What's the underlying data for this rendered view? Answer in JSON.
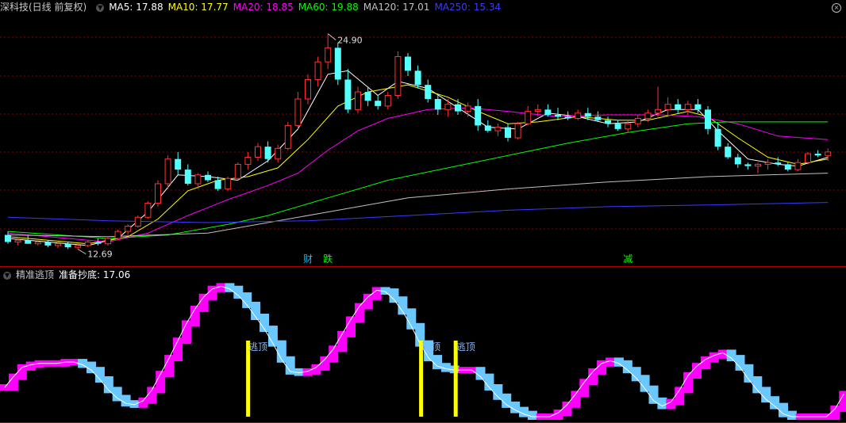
{
  "panel1": {
    "title": "深科技(日线 前复权)",
    "ma_labels": [
      {
        "text": "MA5: 17.88",
        "color": "#ffffff"
      },
      {
        "text": "MA10: 17.77",
        "color": "#ffff00"
      },
      {
        "text": "MA20: 18.85",
        "color": "#ff00ff"
      },
      {
        "text": "MA60: 19.88",
        "color": "#00ff00"
      },
      {
        "text": "MA120: 17.01",
        "color": "#c0c0c0"
      },
      {
        "text": "MA250: 15.34",
        "color": "#3a3aff"
      }
    ],
    "high_label": "24.90",
    "low_label": "12.69",
    "markers": [
      {
        "text": "财",
        "color": "#00c0ff",
        "index": 30
      },
      {
        "text": "跌",
        "color": "#00ff00",
        "index": 32
      },
      {
        "text": "减",
        "color": "#00ff00",
        "index": 62
      }
    ]
  },
  "panel2": {
    "title": "精准逃顶",
    "sub_label": "准备抄底: 17.06",
    "signal_text": "逃顶"
  },
  "colors": {
    "up": "#ff3232",
    "down": "#54ffff",
    "grid": "#8b0000",
    "osc_up": "#ff00ff",
    "osc_down": "#6ac8ff",
    "signal": "#ffff00"
  },
  "chart_data": [
    {
      "type": "candlestick",
      "title": "深科技(日线 前复权)",
      "ylim": [
        12.0,
        26.0
      ],
      "ohlc": [
        [
          13.5,
          13.7,
          13.0,
          13.1
        ],
        [
          13.1,
          13.3,
          12.9,
          13.2
        ],
        [
          13.2,
          13.5,
          13.0,
          13.0
        ],
        [
          13.0,
          13.3,
          12.9,
          13.1
        ],
        [
          13.1,
          13.2,
          12.8,
          12.9
        ],
        [
          12.9,
          13.1,
          12.75,
          13.0
        ],
        [
          13.0,
          13.1,
          12.7,
          12.8
        ],
        [
          12.8,
          13.0,
          12.69,
          12.9
        ],
        [
          12.9,
          13.2,
          12.8,
          13.1
        ],
        [
          13.1,
          13.3,
          12.9,
          13.0
        ],
        [
          13.0,
          13.4,
          12.9,
          13.3
        ],
        [
          13.3,
          13.8,
          13.2,
          13.7
        ],
        [
          13.7,
          14.1,
          13.5,
          14.0
        ],
        [
          14.0,
          14.6,
          13.9,
          14.5
        ],
        [
          14.5,
          15.4,
          14.4,
          15.3
        ],
        [
          15.3,
          16.6,
          15.1,
          16.4
        ],
        [
          16.4,
          18.0,
          16.1,
          17.8
        ],
        [
          17.8,
          18.2,
          16.9,
          17.2
        ],
        [
          17.2,
          17.5,
          16.3,
          16.4
        ],
        [
          16.4,
          17.0,
          16.1,
          16.9
        ],
        [
          16.9,
          17.1,
          16.5,
          16.6
        ],
        [
          16.6,
          16.8,
          16.0,
          16.1
        ],
        [
          16.1,
          16.8,
          16.0,
          16.7
        ],
        [
          16.7,
          17.6,
          16.6,
          17.5
        ],
        [
          17.5,
          18.2,
          17.2,
          17.9
        ],
        [
          17.9,
          18.7,
          17.7,
          18.5
        ],
        [
          18.5,
          18.8,
          17.6,
          17.8
        ],
        [
          17.8,
          18.6,
          17.6,
          18.4
        ],
        [
          18.4,
          19.9,
          18.3,
          19.7
        ],
        [
          19.7,
          21.6,
          19.5,
          21.2
        ],
        [
          21.2,
          22.6,
          20.9,
          22.3
        ],
        [
          22.3,
          23.6,
          21.9,
          23.3
        ],
        [
          23.3,
          24.9,
          22.9,
          24.1
        ],
        [
          24.1,
          24.4,
          22.0,
          22.3
        ],
        [
          22.3,
          22.9,
          20.4,
          20.6
        ],
        [
          20.6,
          21.9,
          20.4,
          21.6
        ],
        [
          21.6,
          21.9,
          20.8,
          21.1
        ],
        [
          21.1,
          21.4,
          20.6,
          20.8
        ],
        [
          20.8,
          21.6,
          20.6,
          21.4
        ],
        [
          21.4,
          23.9,
          21.2,
          23.6
        ],
        [
          23.6,
          23.8,
          22.5,
          22.8
        ],
        [
          22.8,
          23.1,
          21.8,
          22.0
        ],
        [
          22.0,
          22.3,
          21.0,
          21.2
        ],
        [
          21.2,
          21.5,
          20.3,
          20.6
        ],
        [
          20.6,
          21.2,
          20.2,
          20.9
        ],
        [
          20.9,
          21.2,
          20.3,
          20.5
        ],
        [
          20.5,
          21.0,
          20.2,
          20.8
        ],
        [
          20.8,
          21.2,
          19.4,
          19.7
        ],
        [
          19.7,
          20.0,
          19.3,
          19.4
        ],
        [
          19.4,
          19.8,
          19.1,
          19.6
        ],
        [
          19.6,
          19.8,
          18.8,
          19.0
        ],
        [
          19.0,
          19.9,
          18.9,
          19.8
        ],
        [
          19.8,
          20.8,
          19.7,
          20.5
        ],
        [
          20.5,
          20.9,
          20.2,
          20.6
        ],
        [
          20.6,
          20.9,
          20.2,
          20.3
        ],
        [
          20.3,
          20.7,
          20.0,
          20.2
        ],
        [
          20.2,
          20.5,
          20.0,
          20.1
        ],
        [
          20.1,
          20.6,
          20.0,
          20.4
        ],
        [
          20.4,
          20.7,
          20.0,
          20.2
        ],
        [
          20.2,
          20.5,
          19.9,
          20.0
        ],
        [
          20.0,
          20.2,
          19.6,
          19.8
        ],
        [
          19.8,
          20.0,
          19.4,
          19.5
        ],
        [
          19.5,
          20.0,
          19.3,
          19.8
        ],
        [
          19.8,
          20.3,
          19.6,
          20.1
        ],
        [
          20.1,
          20.6,
          19.9,
          20.4
        ],
        [
          20.4,
          21.9,
          20.2,
          20.6
        ],
        [
          20.6,
          21.3,
          20.3,
          20.9
        ],
        [
          20.9,
          21.2,
          20.4,
          20.6
        ],
        [
          20.6,
          21.1,
          20.3,
          20.9
        ],
        [
          20.9,
          21.2,
          20.4,
          20.6
        ],
        [
          20.6,
          20.8,
          19.2,
          19.5
        ],
        [
          19.5,
          19.8,
          18.3,
          18.5
        ],
        [
          18.5,
          18.7,
          17.8,
          17.9
        ],
        [
          17.9,
          18.1,
          17.3,
          17.5
        ],
        [
          17.5,
          17.6,
          17.2,
          17.4
        ],
        [
          17.4,
          17.6,
          17.0,
          17.5
        ],
        [
          17.5,
          17.8,
          17.2,
          17.6
        ],
        [
          17.6,
          17.9,
          17.4,
          17.5
        ],
        [
          17.5,
          17.6,
          17.1,
          17.2
        ],
        [
          17.2,
          17.8,
          17.1,
          17.6
        ],
        [
          17.6,
          18.2,
          17.5,
          18.1
        ],
        [
          18.1,
          18.3,
          17.9,
          18.0
        ],
        [
          18.0,
          18.4,
          17.7,
          18.2
        ]
      ],
      "ma_lines": {
        "MA5": [
          [
            0,
            13.3
          ],
          [
            6,
            13.0
          ],
          [
            8,
            12.9
          ],
          [
            11,
            13.3
          ],
          [
            14,
            14.8
          ],
          [
            17,
            16.9
          ],
          [
            20,
            16.8
          ],
          [
            23,
            16.6
          ],
          [
            26,
            17.7
          ],
          [
            29,
            19.5
          ],
          [
            32,
            22.6
          ],
          [
            34,
            22.8
          ],
          [
            37,
            21.4
          ],
          [
            39,
            22.2
          ],
          [
            42,
            21.8
          ],
          [
            45,
            20.7
          ],
          [
            48,
            19.6
          ],
          [
            51,
            19.5
          ],
          [
            54,
            20.4
          ],
          [
            57,
            20.2
          ],
          [
            60,
            19.8
          ],
          [
            63,
            19.9
          ],
          [
            66,
            20.6
          ],
          [
            69,
            20.6
          ],
          [
            71,
            19.4
          ],
          [
            74,
            17.8
          ],
          [
            77,
            17.5
          ],
          [
            79,
            17.4
          ],
          [
            82,
            17.9
          ]
        ],
        "MA10": [
          [
            0,
            13.4
          ],
          [
            8,
            13.0
          ],
          [
            12,
            13.4
          ],
          [
            15,
            14.4
          ],
          [
            18,
            16.0
          ],
          [
            21,
            16.6
          ],
          [
            24,
            16.8
          ],
          [
            27,
            17.3
          ],
          [
            30,
            18.9
          ],
          [
            33,
            20.8
          ],
          [
            36,
            21.6
          ],
          [
            40,
            22.0
          ],
          [
            44,
            21.3
          ],
          [
            47,
            20.5
          ],
          [
            50,
            19.8
          ],
          [
            53,
            19.9
          ],
          [
            57,
            20.2
          ],
          [
            61,
            20.0
          ],
          [
            64,
            20.0
          ],
          [
            68,
            20.5
          ],
          [
            70,
            20.2
          ],
          [
            73,
            19.0
          ],
          [
            76,
            17.9
          ],
          [
            79,
            17.5
          ],
          [
            82,
            17.8
          ]
        ],
        "MA20": [
          [
            0,
            13.6
          ],
          [
            10,
            13.1
          ],
          [
            14,
            13.6
          ],
          [
            18,
            14.6
          ],
          [
            22,
            15.5
          ],
          [
            26,
            16.3
          ],
          [
            29,
            17.0
          ],
          [
            32,
            18.3
          ],
          [
            35,
            19.4
          ],
          [
            38,
            20.1
          ],
          [
            42,
            20.6
          ],
          [
            46,
            20.7
          ],
          [
            50,
            20.5
          ],
          [
            55,
            20.2
          ],
          [
            60,
            20.3
          ],
          [
            65,
            20.3
          ],
          [
            69,
            20.2
          ],
          [
            73,
            19.8
          ],
          [
            77,
            19.1
          ],
          [
            82,
            18.9
          ]
        ],
        "MA60": [
          [
            0,
            13.7
          ],
          [
            10,
            13.3
          ],
          [
            16,
            13.5
          ],
          [
            22,
            14.1
          ],
          [
            26,
            14.6
          ],
          [
            32,
            15.6
          ],
          [
            38,
            16.6
          ],
          [
            44,
            17.3
          ],
          [
            50,
            18.0
          ],
          [
            56,
            18.7
          ],
          [
            62,
            19.3
          ],
          [
            68,
            19.8
          ],
          [
            72,
            19.9
          ],
          [
            77,
            19.9
          ],
          [
            82,
            19.9
          ]
        ],
        "MA120": [
          [
            0,
            13.5
          ],
          [
            10,
            13.4
          ],
          [
            20,
            13.6
          ],
          [
            26,
            14.2
          ],
          [
            32,
            14.8
          ],
          [
            40,
            15.6
          ],
          [
            50,
            16.1
          ],
          [
            60,
            16.5
          ],
          [
            70,
            16.8
          ],
          [
            76,
            16.9
          ],
          [
            82,
            17.0
          ]
        ],
        "MA250": [
          [
            0,
            14.5
          ],
          [
            10,
            14.3
          ],
          [
            20,
            14.2
          ],
          [
            30,
            14.3
          ],
          [
            40,
            14.6
          ],
          [
            50,
            14.9
          ],
          [
            60,
            15.1
          ],
          [
            70,
            15.2
          ],
          [
            82,
            15.34
          ]
        ]
      }
    },
    {
      "type": "step",
      "title": "精准逃顶",
      "ylim": [
        0,
        100
      ],
      "values": [
        22,
        30,
        37,
        39,
        40,
        40,
        40,
        41,
        41,
        39,
        35,
        28,
        20,
        14,
        10,
        9,
        12,
        20,
        32,
        44,
        57,
        70,
        81,
        90,
        96,
        98,
        96,
        91,
        84,
        75,
        66,
        55,
        43,
        34,
        33,
        34,
        37,
        43,
        51,
        62,
        73,
        83,
        90,
        95,
        94,
        88,
        79,
        68,
        55,
        44,
        38,
        36,
        35,
        35,
        35,
        30,
        22,
        15,
        9,
        5,
        2,
        0,
        0,
        0,
        3,
        9,
        17,
        26,
        34,
        40,
        42,
        40,
        35,
        29,
        21,
        12,
        8,
        11,
        20,
        31,
        38,
        43,
        46,
        48,
        44,
        37,
        28,
        20,
        13,
        8,
        2,
        0,
        0,
        0,
        0,
        0,
        6,
        17
      ],
      "signals": [
        29,
        49,
        53
      ]
    }
  ]
}
